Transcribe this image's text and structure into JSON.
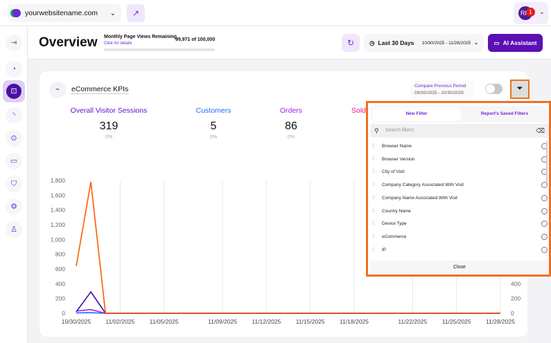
{
  "topbar": {
    "site": "yourwebsitename.com",
    "user_initials": "RF",
    "notification_count": "1"
  },
  "sidebar": {
    "items": [
      "toggle",
      "dashboard",
      "ecommerce",
      "engagement",
      "privacy",
      "feedback",
      "security",
      "settings",
      "account"
    ],
    "active": "ecommerce"
  },
  "header": {
    "title": "Overview",
    "page_views_label": "Monthly Page Views Remaining",
    "page_views_link": "Click for details",
    "page_views_count": "99,971 of 100,000",
    "page_views_used_fraction": 0.0003,
    "date_preset": "Last 30 Days",
    "date_range": "10/30/2025 - 11/28/2025",
    "ai_button": "AI Assistant"
  },
  "card": {
    "title": "eCommerce KPIs",
    "compare_label": "Compare Previous Period",
    "compare_range": "09/30/2025 - 10/30/2025",
    "compare_enabled": false,
    "kpis": [
      {
        "label": "Overall Visitor Sessions",
        "value": "319",
        "change": "0%",
        "color": "#5b12c9"
      },
      {
        "label": "Customers",
        "value": "5",
        "change": "0%",
        "color": "#1a6bff"
      },
      {
        "label": "Orders",
        "value": "86",
        "change": "0%",
        "color": "#9b1fe8"
      },
      {
        "label": "Sold",
        "color": "#e8178f"
      }
    ]
  },
  "filter_panel": {
    "tabs": [
      "New Filter",
      "Report's Saved Filters"
    ],
    "active_tab": "New Filter",
    "search_placeholder": "Search filters",
    "items": [
      "Browser Name",
      "Browser Version",
      "City of Visit",
      "Company Category Associated With Visit",
      "Company Name Associated With Visit",
      "Country Name",
      "Device Type",
      "eCommerce",
      "IP"
    ],
    "close": "Close"
  },
  "chart_data": {
    "type": "line",
    "x": [
      "10/30/2025",
      "10/31/2025",
      "11/01/2025",
      "11/02/2025",
      "11/03/2025",
      "11/04/2025",
      "11/05/2025",
      "11/06/2025",
      "11/07/2025",
      "11/08/2025",
      "11/09/2025",
      "11/10/2025",
      "11/11/2025",
      "11/12/2025",
      "11/13/2025",
      "11/14/2025",
      "11/15/2025",
      "11/16/2025",
      "11/17/2025",
      "11/18/2025",
      "11/19/2025",
      "11/20/2025",
      "11/21/2025",
      "11/22/2025",
      "11/23/2025",
      "11/24/2025",
      "11/25/2025",
      "11/26/2025",
      "11/27/2025",
      "11/28/2025"
    ],
    "x_tick_labels": [
      "10/30/2025",
      "11/02/2025",
      "11/05/2025",
      "11/09/2025",
      "11/12/2025",
      "11/15/2025",
      "11/18/2025",
      "11/22/2025",
      "11/25/2025",
      "11/28/2025"
    ],
    "y_tick_labels": [
      "0",
      "200",
      "400",
      "600",
      "800",
      "1,000",
      "1,200",
      "1,400",
      "1,600",
      "1,800"
    ],
    "right_y_tick_labels": [
      "0",
      "200",
      "400"
    ],
    "ylim": [
      0,
      1800
    ],
    "grid": "vertical",
    "series": [
      {
        "color": "#ff5a00",
        "values": [
          640,
          1780,
          0,
          0,
          0,
          0,
          0,
          0,
          0,
          0,
          0,
          0,
          0,
          0,
          0,
          0,
          0,
          0,
          0,
          0,
          0,
          0,
          0,
          0,
          0,
          0,
          0,
          0,
          0,
          0
        ]
      },
      {
        "color": "#3a0ca3",
        "values": [
          20,
          290,
          0,
          0,
          0,
          0,
          0,
          0,
          0,
          0,
          0,
          0,
          0,
          0,
          0,
          0,
          0,
          0,
          0,
          0,
          0,
          0,
          0,
          0,
          0,
          0,
          0,
          0,
          0,
          0
        ]
      },
      {
        "color": "#9b1fe8",
        "values": [
          30,
          50,
          0,
          0,
          0,
          0,
          0,
          0,
          0,
          0,
          0,
          0,
          0,
          0,
          0,
          0,
          0,
          0,
          0,
          0,
          0,
          0,
          0,
          0,
          0,
          0,
          0,
          0,
          0,
          0
        ]
      },
      {
        "color": "#1a6bff",
        "values": [
          5,
          8,
          0,
          0,
          0,
          0,
          0,
          0,
          0,
          0,
          0,
          0,
          0,
          0,
          0,
          0,
          0,
          0,
          0,
          0,
          0,
          0,
          0,
          0,
          0,
          0,
          0,
          0,
          0,
          0
        ]
      }
    ]
  }
}
